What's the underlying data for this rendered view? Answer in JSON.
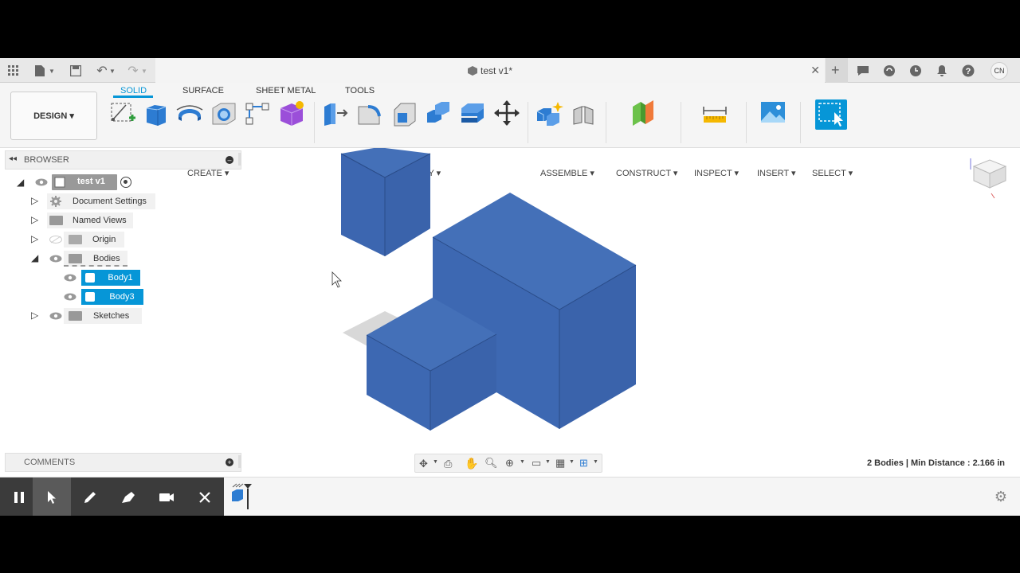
{
  "titlebar": {
    "doc_title": "test v1*",
    "avatar": "CN",
    "icons": [
      "grid-icon",
      "file-icon",
      "save-icon",
      "undo-icon",
      "redo-icon",
      "close-icon",
      "plus-icon",
      "chat-icon",
      "sync-icon",
      "clock-icon",
      "bell-icon",
      "help-icon"
    ]
  },
  "ribbon": {
    "workspace": "DESIGN ▾",
    "tabs": [
      "SOLID",
      "SURFACE",
      "SHEET METAL",
      "TOOLS"
    ],
    "active_tab": "SOLID",
    "groups": [
      "CREATE ▾",
      "MODIFY ▾",
      "ASSEMBLE ▾",
      "CONSTRUCT ▾",
      "INSPECT ▾",
      "INSERT ▾",
      "SELECT ▾"
    ]
  },
  "browser": {
    "header": "BROWSER",
    "root": "test v1",
    "items": [
      "Document Settings",
      "Named Views",
      "Origin",
      "Bodies",
      "Sketches"
    ],
    "bodies": [
      "Body1",
      "Body3"
    ]
  },
  "comments": {
    "label": "COMMENTS"
  },
  "status": {
    "text": "2 Bodies | Min Distance : 2.166 in"
  },
  "colors": {
    "accent": "#0696d7",
    "body_blue": "#3a65ad"
  }
}
